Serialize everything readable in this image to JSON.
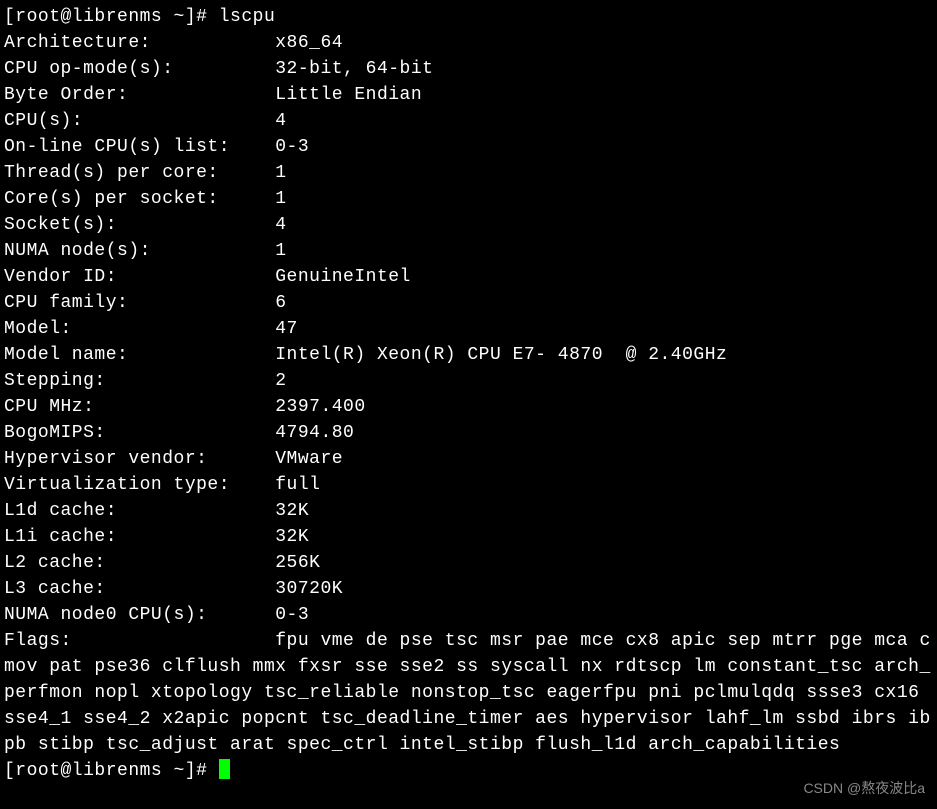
{
  "prompt1": "[root@librenms ~]# ",
  "command": "lscpu",
  "fields": [
    {
      "label": "Architecture:",
      "value": "x86_64"
    },
    {
      "label": "CPU op-mode(s):",
      "value": "32-bit, 64-bit"
    },
    {
      "label": "Byte Order:",
      "value": "Little Endian"
    },
    {
      "label": "CPU(s):",
      "value": "4"
    },
    {
      "label": "On-line CPU(s) list:",
      "value": "0-3"
    },
    {
      "label": "Thread(s) per core:",
      "value": "1"
    },
    {
      "label": "Core(s) per socket:",
      "value": "1"
    },
    {
      "label": "Socket(s):",
      "value": "4"
    },
    {
      "label": "NUMA node(s):",
      "value": "1"
    },
    {
      "label": "Vendor ID:",
      "value": "GenuineIntel"
    },
    {
      "label": "CPU family:",
      "value": "6"
    },
    {
      "label": "Model:",
      "value": "47"
    },
    {
      "label": "Model name:",
      "value": "Intel(R) Xeon(R) CPU E7- 4870  @ 2.40GHz"
    },
    {
      "label": "Stepping:",
      "value": "2"
    },
    {
      "label": "CPU MHz:",
      "value": "2397.400"
    },
    {
      "label": "BogoMIPS:",
      "value": "4794.80"
    },
    {
      "label": "Hypervisor vendor:",
      "value": "VMware"
    },
    {
      "label": "Virtualization type:",
      "value": "full"
    },
    {
      "label": "L1d cache:",
      "value": "32K"
    },
    {
      "label": "L1i cache:",
      "value": "32K"
    },
    {
      "label": "L2 cache:",
      "value": "256K"
    },
    {
      "label": "L3 cache:",
      "value": "30720K"
    },
    {
      "label": "NUMA node0 CPU(s):",
      "value": "0-3"
    }
  ],
  "flagsLabel": "Flags:",
  "flagsValue": "fpu vme de pse tsc msr pae mce cx8 apic sep mtrr pge mca cmov pat pse36 clflush mmx fxsr sse sse2 ss syscall nx rdtscp lm constant_tsc arch_perfmon nopl xtopology tsc_reliable nonstop_tsc eagerfpu pni pclmulqdq ssse3 cx16 sse4_1 sse4_2 x2apic popcnt tsc_deadline_timer aes hypervisor lahf_lm ssbd ibrs ibpb stibp tsc_adjust arat spec_ctrl intel_stibp flush_l1d arch_capabilities",
  "prompt2": "[root@librenms ~]# ",
  "watermark": "CSDN @熬夜波比a",
  "labelCol": 24
}
